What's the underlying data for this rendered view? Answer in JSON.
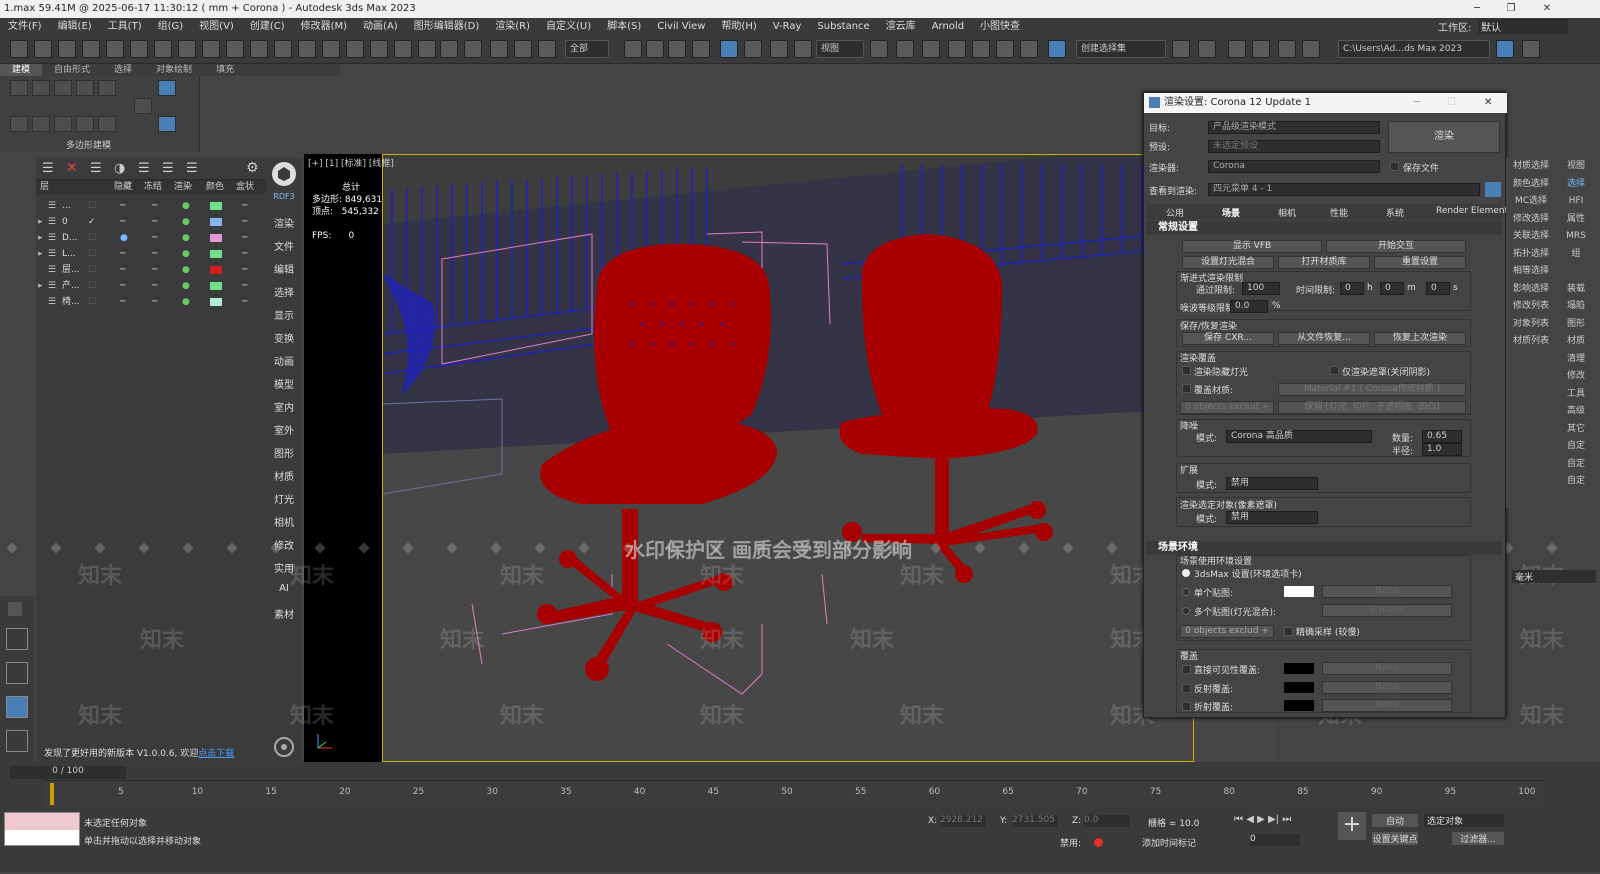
{
  "title": "1.max  59.41M @ 2025-06-17 11:30:12  ( mm + Corona ) - Autodesk 3ds Max 2023",
  "menu": [
    "文件(F)",
    "编辑(E)",
    "工具(T)",
    "组(G)",
    "视图(V)",
    "创建(C)",
    "修改器(M)",
    "动画(A)",
    "图形编辑器(D)",
    "渲染(R)",
    "自定义(U)",
    "脚本(S)",
    "Civil View",
    "帮助(H)",
    "V-Ray",
    "Substance",
    "渲云库",
    "Arnold",
    "小图快查"
  ],
  "workspace_label": "工作区:",
  "workspace_value": "默认",
  "toolbar": {
    "filter": "全部",
    "viewmode": "视图",
    "selection_set": "创建选择集",
    "path": "C:\\Users\\Ad…ds Max 2023"
  },
  "ribbon_tabs": [
    "建模",
    "自由形式",
    "选择",
    "对象绘制",
    "填充"
  ],
  "ribbon_label": "多边形建模",
  "layer_header": {
    "name": "层",
    "hide": "隐藏",
    "freeze": "冻结",
    "render": "渲染",
    "color": "颜色",
    "box": "盒状"
  },
  "layers": [
    {
      "name": "...",
      "color": "#6ee08a"
    },
    {
      "name": "0",
      "color": "#8ab4f0",
      "active": true
    },
    {
      "name": "D...",
      "color": "#e59ad8"
    },
    {
      "name": "L...",
      "color": "#6ee08a"
    },
    {
      "name": "层...",
      "color": "#d02020"
    },
    {
      "name": "产...",
      "color": "#6ee08a"
    },
    {
      "name": "椅...",
      "color": "#b0ecd4"
    }
  ],
  "side_cmd": [
    "RDF3",
    "渲染",
    "文件",
    "编辑",
    "选择",
    "显示",
    "变换",
    "动画",
    "模型",
    "室内",
    "室外",
    "图形",
    "材质",
    "灯光",
    "相机",
    "修改",
    "实用",
    "AI",
    "素材"
  ],
  "update_notice": "发现了更好用的新版本 V1.0.0.6, 欢迎",
  "update_link": "点击下载",
  "viewport": {
    "label": "[+] [1] [标准] [线框]",
    "stats_title": "总计",
    "polys_label": "多边形:",
    "polys": "849,631",
    "verts_label": "顶点:",
    "verts": "545,332",
    "fps_label": "FPS:",
    "fps": "0"
  },
  "watermark": "水印保护区  画质会受到部分影响",
  "watermark_brand": "知末",
  "render": {
    "title": "渲染设置: Corona 12 Update 1",
    "target_label": "目标:",
    "target": "产品级渲染模式",
    "preset_label": "预设:",
    "preset": "未选定预设",
    "renderer_label": "渲染器:",
    "renderer": "Corona",
    "save_file": "保存文件",
    "view_label": "查看到渲染:",
    "view": "四元菜单 4 - 1",
    "render_btn": "渲染",
    "tabs": [
      "公用",
      "场景",
      "相机",
      "性能",
      "系统",
      "Render Elements"
    ],
    "sec_general": "常规设置",
    "btn_vfb": "显示 VFB",
    "btn_interactive": "开始交互",
    "btn_lightmix": "设置灯光混合",
    "btn_matlib": "打开材质库",
    "btn_reset": "重置设置",
    "prog_label": "渐进式渲染限制",
    "pass_label": "通过限制:",
    "pass": "100",
    "time_label": "时间限制:",
    "time_h": "0",
    "h": "h",
    "time_m": "0",
    "m": "m",
    "time_s": "0",
    "s": "s",
    "noise_label": "噪波等级限制:",
    "noise": "0.0",
    "pct": "%",
    "save_label": "保存/恢复渲染",
    "btn_save_cxr": "保存 CXR...",
    "btn_restore_file": "从文件恢复...",
    "btn_restore_last": "恢复上次渲染",
    "override_label": "渲染覆盖",
    "hidden_lights": "渲染隐藏灯光",
    "mask_only": "仅渲染遮罩(关闭阴影)",
    "override_mtl": "覆盖材质:",
    "mtl_value": "Material #1 ( Corona传统材质 )",
    "objects_exclude": "0 objects exclud +",
    "keep": "保留 [灯光, 切片, 不透明度, 凹凸]",
    "denoise_label": "降噪",
    "mode_label": "模式:",
    "denoise_mode": "Corona 高品质",
    "amount_label": "数量:",
    "amount": "0.65",
    "radius_label": "半径:",
    "radius": "1.0",
    "ext_label": "扩展",
    "ext_mode": "禁用",
    "sel_label": "渲染选定对象(像素遮罩)",
    "sel_mode": "禁用",
    "sec_env": "场景环境",
    "env_label": "场景使用环境设置",
    "env_3dsmax": "3dsMax 设置(环境选项卡)",
    "single_map": "单个贴图:",
    "none": "None",
    "multi_map": "多个贴图(灯光混合):",
    "maps": "2 maps",
    "objects_exclude2": "0 objects exclud +",
    "precise": "精确采样 (较慢)",
    "cover_label": "覆盖",
    "direct": "直接可见性覆盖:",
    "reflect": "反射覆盖:",
    "refract": "折射覆盖:"
  },
  "right_panel": [
    "材质选择",
    "视图",
    "颜色选择",
    "选择",
    "MC选择",
    "HFI",
    "修改选择",
    "属性",
    "关联选择",
    "MRS",
    "拓扑选择",
    "组",
    "相等选择",
    "",
    "影响选择",
    "装载",
    "修改列表",
    "塌陷",
    "对象列表",
    "图形",
    "材质列表",
    "材质",
    "",
    "清理",
    "",
    "修改",
    "",
    "工具",
    "",
    "高级",
    "",
    "其它",
    "",
    "自定",
    "",
    "自定",
    "",
    "自定"
  ],
  "timeline": {
    "frame": "0 / 100",
    "ticks": [
      "5",
      "10",
      "15",
      "20",
      "25",
      "30",
      "35",
      "40",
      "45",
      "50",
      "55",
      "60",
      "65",
      "70",
      "75",
      "80",
      "85",
      "90",
      "95",
      "100"
    ]
  },
  "status": {
    "none_selected": "未选定任何对象",
    "hint": "单击并拖动以选择并移动对象",
    "x_label": "X:",
    "x": "2928.212",
    "y_label": "Y:",
    "y": "2731.505",
    "z_label": "Z:",
    "z": "0.0",
    "grid": "栅格 = 10.0",
    "auto": "自动",
    "selected": "选定对象",
    "set_key": "设置关键点",
    "filter": "过滤器...",
    "disabled": "禁用:",
    "add_tag": "添加时间标记",
    "frame0": "0",
    "unit": "毫米"
  }
}
